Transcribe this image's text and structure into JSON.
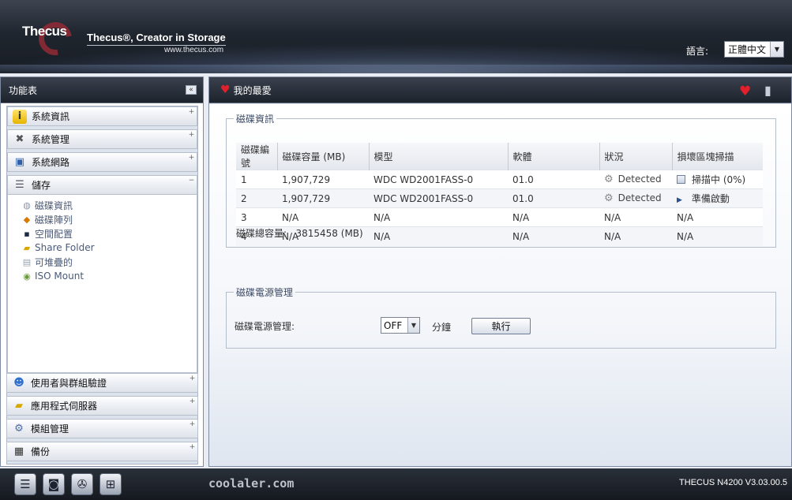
{
  "header": {
    "logo_text": "Thecus",
    "tagline": "Thecus®, Creator in Storage",
    "url": "www.thecus.com",
    "lang_label": "語言:",
    "lang_value": "正體中文"
  },
  "left_panel": {
    "title": "功能表",
    "collapse_icon": "double-chevron-left-icon",
    "menu_top": [
      {
        "label": "系統資訊",
        "icon": "info-icon"
      },
      {
        "label": "系統管理",
        "icon": "tools-icon"
      },
      {
        "label": "系統網路",
        "icon": "network-icon"
      },
      {
        "label": "儲存",
        "icon": "storage-icon"
      }
    ],
    "storage_sub": [
      {
        "label": "磁碟資訊",
        "icon": "disk-icon"
      },
      {
        "label": "磁碟陣列",
        "icon": "raid-icon"
      },
      {
        "label": "空間配置",
        "icon": "space-icon"
      },
      {
        "label": "Share Folder",
        "icon": "folder-icon"
      },
      {
        "label": "可堆疊的",
        "icon": "stack-icon"
      },
      {
        "label": "ISO Mount",
        "icon": "iso-icon"
      }
    ],
    "menu_bottom": [
      {
        "label": "使用者與群組驗證",
        "icon": "users-icon"
      },
      {
        "label": "應用程式伺服器",
        "icon": "app-server-icon"
      },
      {
        "label": "模組管理",
        "icon": "module-gear-icon"
      },
      {
        "label": "備份",
        "icon": "backup-icon"
      }
    ]
  },
  "right_panel": {
    "title": "我的最愛",
    "disk_info": {
      "legend": "磁碟資訊",
      "columns": [
        "磁碟編號",
        "磁碟容量 (MB)",
        "模型",
        "軟體",
        "狀況",
        "損壞區塊掃描"
      ],
      "rows": [
        {
          "no": "1",
          "capacity": "1,907,729",
          "model": "WDC WD2001FASS-0",
          "firmware": "01.0",
          "status": "Detected",
          "scan": "掃描中 (0%)"
        },
        {
          "no": "2",
          "capacity": "1,907,729",
          "model": "WDC WD2001FASS-0",
          "firmware": "01.0",
          "status": "Detected",
          "scan": "準備啟動"
        },
        {
          "no": "3",
          "capacity": "N/A",
          "model": "N/A",
          "firmware": "N/A",
          "status": "N/A",
          "scan": "N/A"
        },
        {
          "no": "4",
          "capacity": "N/A",
          "model": "N/A",
          "firmware": "N/A",
          "status": "N/A",
          "scan": "N/A"
        }
      ],
      "total_label": "磁碟總容量:",
      "total_value": "3815458 (MB)"
    },
    "disk_power": {
      "legend": "磁碟電源管理",
      "label": "磁碟電源管理:",
      "select_value": "OFF",
      "unit": "分鐘",
      "execute_label": "執行"
    }
  },
  "footer": {
    "watermark": "coolaler.com",
    "version": "THECUS N4200 V3.03.00.5"
  }
}
